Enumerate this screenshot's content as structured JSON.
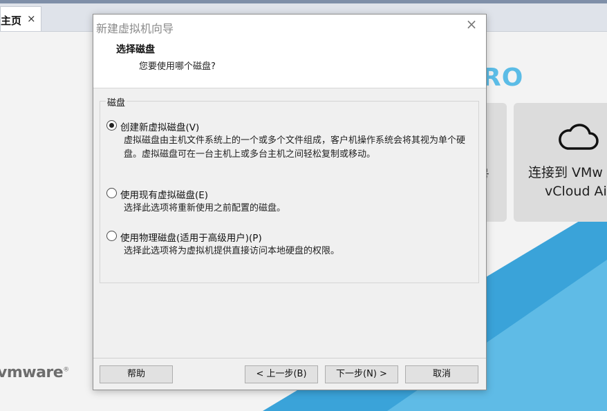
{
  "app": {
    "tab": {
      "label": "主页",
      "close_icon": "×"
    },
    "brand_suffix": "RO",
    "tile_left_text": "号",
    "tile_right": {
      "line1": "连接到 VMw",
      "line2": "vCloud Ai",
      "icon": "cloud-icon"
    },
    "logo": {
      "text": "vmware",
      "mark": "®"
    },
    "colors": {
      "accent": "#5bbce6",
      "diagonal": "#3aa3d9"
    }
  },
  "dialog": {
    "title": "新建虚拟机向导",
    "close_icon": "×",
    "step_title": "选择磁盘",
    "step_subtitle": "您要使用哪个磁盘?",
    "group_label": "磁盘",
    "options": [
      {
        "label": "创建新虚拟磁盘(V)",
        "description": "虚拟磁盘由主机文件系统上的一个或多个文件组成，客户机操作系统会将其视为单个硬盘。虚拟磁盘可在一台主机上或多台主机之间轻松复制或移动。",
        "checked": true
      },
      {
        "label": "使用现有虚拟磁盘(E)",
        "description": "选择此选项将重新使用之前配置的磁盘。",
        "checked": false
      },
      {
        "label": "使用物理磁盘(适用于高级用户)(P)",
        "description": "选择此选项将为虚拟机提供直接访问本地硬盘的权限。",
        "checked": false
      }
    ],
    "buttons": {
      "help": "帮助",
      "back": "< 上一步(B)",
      "next": "下一步(N) >",
      "cancel": "取消"
    }
  }
}
